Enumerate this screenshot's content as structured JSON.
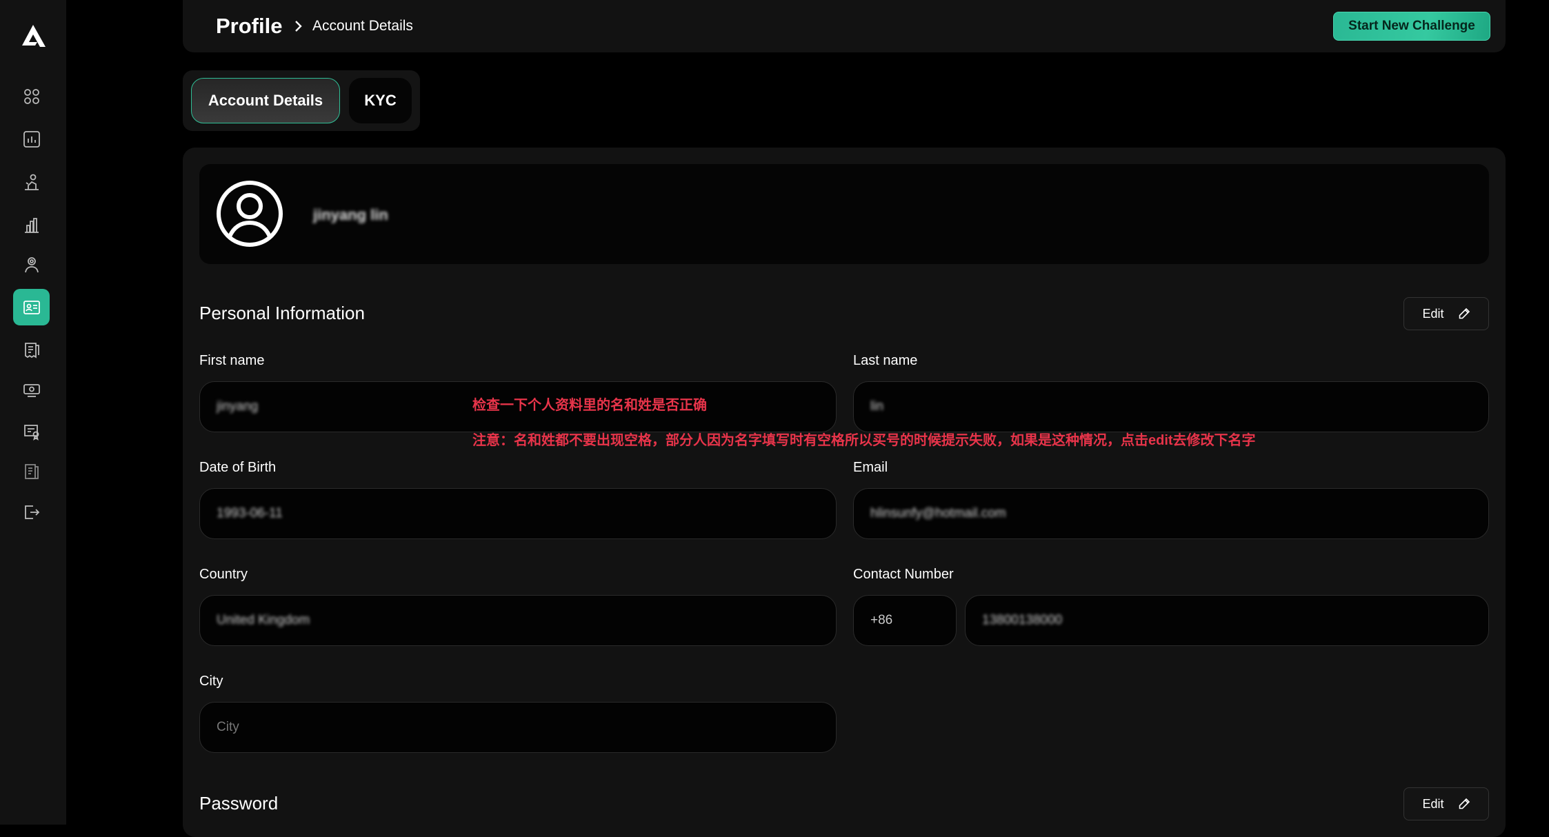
{
  "app": {
    "logo_icon": "brand-logo-icon"
  },
  "sidebar": {
    "items": [
      {
        "name": "dashboard",
        "icon": "grid-icon"
      },
      {
        "name": "stats",
        "icon": "chart-box-icon"
      },
      {
        "name": "trading",
        "icon": "trader-icon"
      },
      {
        "name": "leaderboard",
        "icon": "bar-chart-icon"
      },
      {
        "name": "affiliate",
        "icon": "users-network-icon"
      },
      {
        "name": "profile",
        "icon": "id-card-icon",
        "active": true
      },
      {
        "name": "orders",
        "icon": "receipt-icon"
      },
      {
        "name": "payouts",
        "icon": "money-icon"
      },
      {
        "name": "certificates",
        "icon": "certificate-icon"
      },
      {
        "name": "documents",
        "icon": "document-icon"
      },
      {
        "name": "logout",
        "icon": "logout-icon"
      }
    ]
  },
  "header": {
    "title": "Profile",
    "subtitle": "Account Details",
    "cta_label": "Start New Challenge"
  },
  "tabs": [
    {
      "label": "Account Details",
      "active": true
    },
    {
      "label": "KYC",
      "active": false
    }
  ],
  "profile": {
    "name": "jinyang lin"
  },
  "personal": {
    "title": "Personal Information",
    "edit_label": "Edit",
    "first_name": {
      "label": "First name",
      "value": "jinyang"
    },
    "last_name": {
      "label": "Last name",
      "value": "lin"
    },
    "dob": {
      "label": "Date of Birth",
      "value": "1993-06-11"
    },
    "email": {
      "label": "Email",
      "value": "hlinsunfy@hotmail.com"
    },
    "country": {
      "label": "Country",
      "value": "United Kingdom"
    },
    "contact": {
      "label": "Contact Number",
      "code": "+86",
      "value": "13800138000"
    },
    "city": {
      "label": "City",
      "placeholder": "City"
    }
  },
  "notes": {
    "line1": "检查一下个人资料里的名和姓是否正确",
    "line2": "注意：名和姓都不要出现空格，部分人因为名字填写时有空格所以买号的时候提示失败，如果是这种情况，点击edit去修改下名字"
  },
  "password": {
    "title": "Password",
    "edit_label": "Edit"
  },
  "colors": {
    "accent": "#2ab894",
    "note": "#e8344a",
    "background": "#000000",
    "panel": "#121212"
  }
}
